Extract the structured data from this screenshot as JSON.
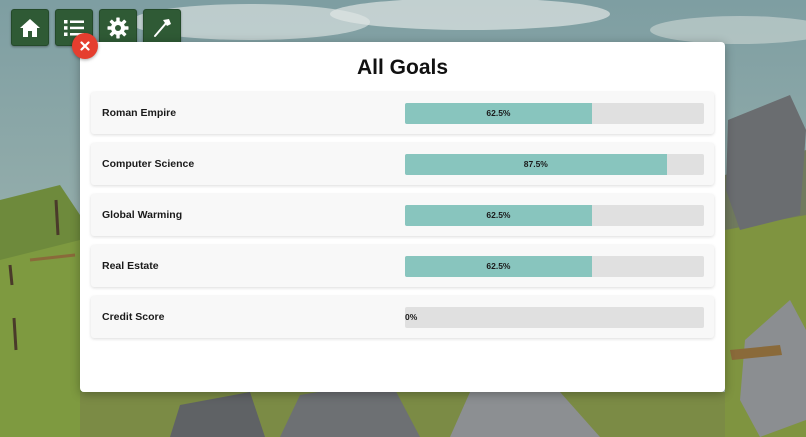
{
  "toolbar": {
    "buttons": [
      {
        "icon": "home-icon"
      },
      {
        "icon": "list-icon"
      },
      {
        "icon": "gear-icon"
      },
      {
        "icon": "axe-icon"
      }
    ]
  },
  "dialog": {
    "title": "All Goals",
    "close_icon": "close-icon",
    "goals": [
      {
        "name": "Roman Empire",
        "progress": 62.5,
        "label": "62.5%"
      },
      {
        "name": "Computer Science",
        "progress": 87.5,
        "label": "87.5%"
      },
      {
        "name": "Global Warming",
        "progress": 62.5,
        "label": "62.5%"
      },
      {
        "name": "Real Estate",
        "progress": 62.5,
        "label": "62.5%"
      },
      {
        "name": "Credit Score",
        "progress": 0,
        "label": "0%"
      }
    ]
  },
  "colors": {
    "toolbar_button": "#2f5a35",
    "close_button": "#e53e2f",
    "progress_fill": "#88c5be",
    "progress_track": "#e0e0e0"
  }
}
